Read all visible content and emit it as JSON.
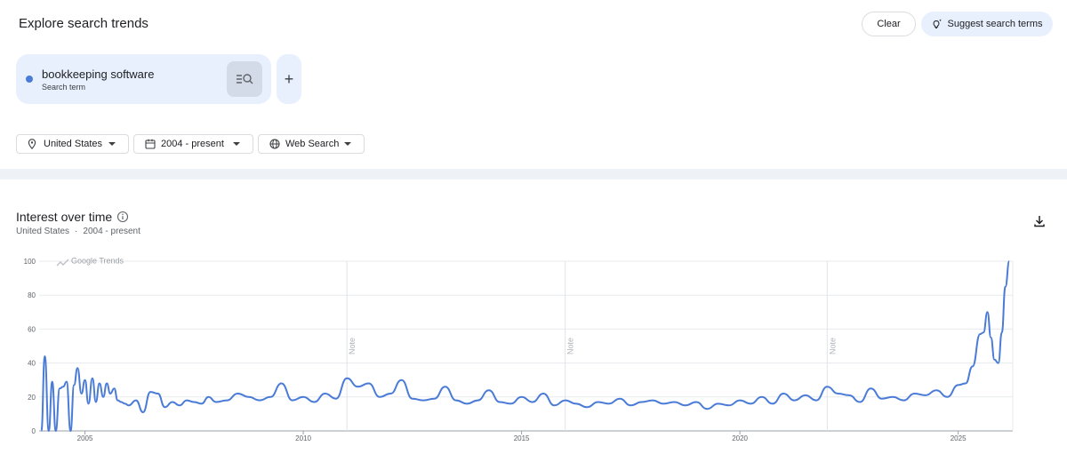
{
  "header": {
    "title": "Explore search trends",
    "clear_label": "Clear",
    "suggest_label": "Suggest search terms"
  },
  "term": {
    "name": "bookkeeping software",
    "type": "Search term",
    "color": "#4a7bd6"
  },
  "filters": {
    "region": "United States",
    "period": "2004 - present",
    "property": "Web Search"
  },
  "section": {
    "title": "Interest over time",
    "region": "United States",
    "separator": "·",
    "period": "2004 - present"
  },
  "chart_data": {
    "type": "line",
    "watermark": "Google Trends",
    "ylim": [
      0,
      100
    ],
    "yticks": [
      0,
      20,
      40,
      60,
      80,
      100
    ],
    "xlim": [
      2003.95,
      2026.25
    ],
    "xticks": [
      {
        "value": 2005,
        "label": "2005"
      },
      {
        "value": 2010,
        "label": "2010"
      },
      {
        "value": 2015,
        "label": "2015"
      },
      {
        "value": 2020,
        "label": "2020"
      },
      {
        "value": 2025,
        "label": "2025"
      }
    ],
    "notes": [
      {
        "x": 2011.0,
        "label": "Note"
      },
      {
        "x": 2016.0,
        "label": "Note"
      },
      {
        "x": 2022.0,
        "label": "Note"
      }
    ],
    "grid": true,
    "series": [
      {
        "color": "#4a7bd6",
        "x": [
          2004.0,
          2004.08,
          2004.17,
          2004.25,
          2004.33,
          2004.42,
          2004.5,
          2004.58,
          2004.67,
          2004.75,
          2004.83,
          2004.92,
          2005.0,
          2005.08,
          2005.17,
          2005.25,
          2005.33,
          2005.42,
          2005.5,
          2005.58,
          2005.67,
          2005.75,
          2005.83,
          2005.92,
          2006.0,
          2006.17,
          2006.33,
          2006.5,
          2006.67,
          2006.83,
          2007.0,
          2007.17,
          2007.33,
          2007.5,
          2007.67,
          2007.83,
          2008.0,
          2008.25,
          2008.5,
          2008.75,
          2009.0,
          2009.25,
          2009.5,
          2009.75,
          2010.0,
          2010.25,
          2010.5,
          2010.75,
          2011.0,
          2011.25,
          2011.5,
          2011.75,
          2012.0,
          2012.25,
          2012.5,
          2012.75,
          2013.0,
          2013.25,
          2013.5,
          2013.75,
          2014.0,
          2014.25,
          2014.5,
          2014.75,
          2015.0,
          2015.25,
          2015.5,
          2015.75,
          2016.0,
          2016.25,
          2016.5,
          2016.75,
          2017.0,
          2017.25,
          2017.5,
          2017.75,
          2018.0,
          2018.25,
          2018.5,
          2018.75,
          2019.0,
          2019.25,
          2019.5,
          2019.75,
          2020.0,
          2020.25,
          2020.5,
          2020.75,
          2021.0,
          2021.25,
          2021.5,
          2021.75,
          2022.0,
          2022.25,
          2022.5,
          2022.75,
          2023.0,
          2023.25,
          2023.5,
          2023.75,
          2024.0,
          2024.25,
          2024.5,
          2024.75,
          2025.0,
          2025.17,
          2025.33,
          2025.5,
          2025.58,
          2025.67,
          2025.75,
          2025.83,
          2025.92,
          2026.0,
          2026.08,
          2026.17
        ],
        "values": [
          0,
          44,
          0,
          29,
          0,
          25,
          26,
          29,
          0,
          27,
          37,
          22,
          30,
          16,
          31,
          17,
          28,
          20,
          28,
          22,
          25,
          18,
          17,
          16,
          15,
          18,
          11,
          23,
          22,
          14,
          17,
          15,
          18,
          17,
          16,
          20,
          17,
          18,
          22,
          20,
          18,
          20,
          28,
          18,
          20,
          17,
          22,
          19,
          31,
          26,
          28,
          20,
          22,
          30,
          19,
          18,
          19,
          26,
          18,
          16,
          18,
          24,
          17,
          16,
          20,
          17,
          22,
          15,
          18,
          16,
          14,
          17,
          16,
          19,
          15,
          17,
          18,
          16,
          17,
          15,
          17,
          13,
          16,
          15,
          18,
          16,
          20,
          16,
          22,
          18,
          21,
          18,
          26,
          22,
          21,
          17,
          25,
          19,
          20,
          18,
          22,
          21,
          24,
          20,
          27,
          28,
          38,
          57,
          58,
          70,
          55,
          42,
          40,
          58,
          85,
          100
        ]
      }
    ]
  }
}
